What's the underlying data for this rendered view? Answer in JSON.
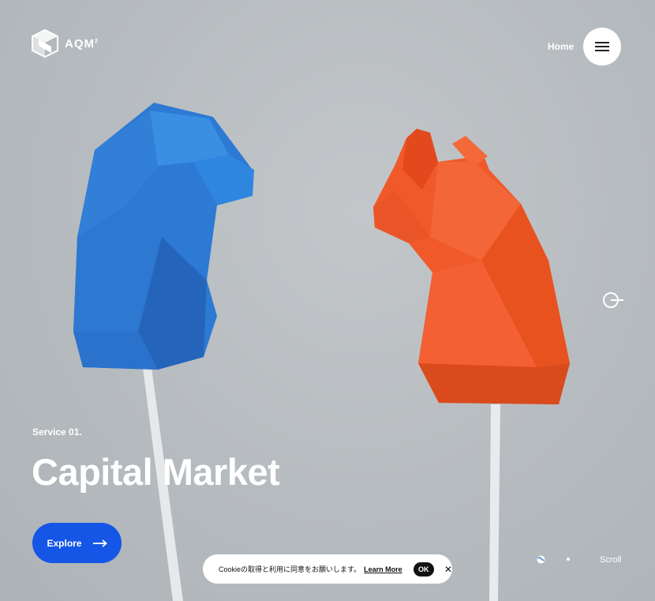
{
  "brand": {
    "name": "AQM",
    "superscript": "2"
  },
  "nav": {
    "home_label": "Home",
    "menu_icon": "hamburger-icon"
  },
  "hero": {
    "eyebrow": "Service 01.",
    "title": "Capital Market",
    "cta_label": "Explore",
    "cta_icon": "arrow-right-icon"
  },
  "cookie_banner": {
    "text": "Cookieの取得と利用に同意をお願いします。",
    "link_label": "Learn More",
    "ok_label": "OK",
    "close_icon": "close-icon"
  },
  "footer": {
    "scroll_label": "Scroll",
    "language_icon": "globe-icon"
  },
  "colors": {
    "accent": "#1556e6",
    "bear": "#2f7fd6",
    "bull": "#f15a2b",
    "background": "#b8bdc1"
  }
}
